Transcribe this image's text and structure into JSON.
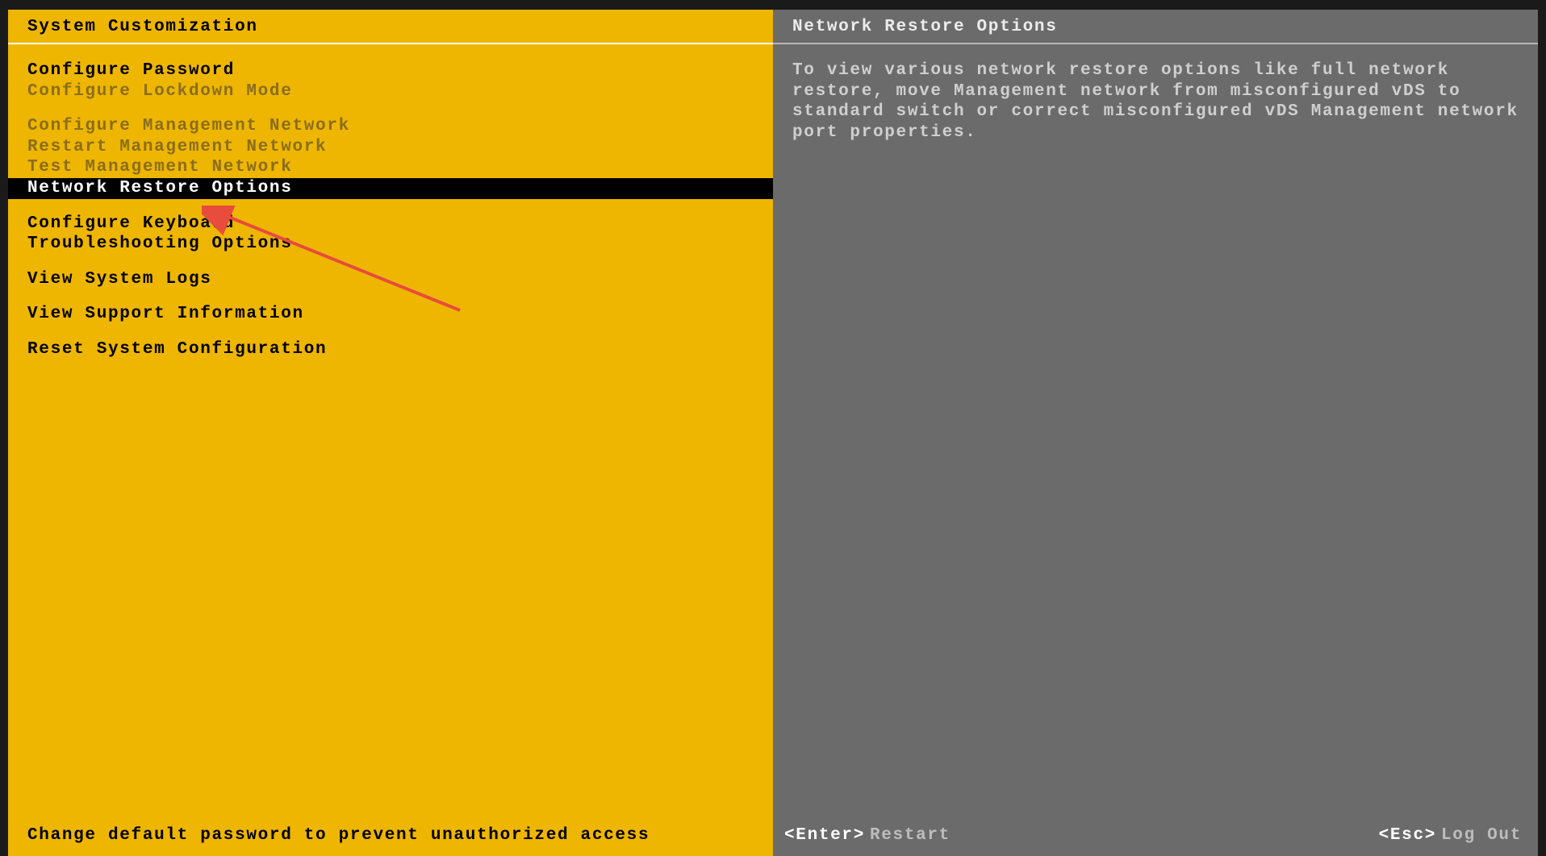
{
  "left": {
    "title": "System Customization",
    "footer": "Change default password to prevent unauthorized access",
    "groups": [
      [
        {
          "label": "Configure Password",
          "disabled": false,
          "selected": false
        },
        {
          "label": "Configure Lockdown Mode",
          "disabled": true,
          "selected": false
        }
      ],
      [
        {
          "label": "Configure Management Network",
          "disabled": true,
          "selected": false
        },
        {
          "label": "Restart Management Network",
          "disabled": true,
          "selected": false
        },
        {
          "label": "Test Management Network",
          "disabled": true,
          "selected": false
        },
        {
          "label": "Network Restore Options",
          "disabled": false,
          "selected": true
        }
      ],
      [
        {
          "label": "Configure Keyboard",
          "disabled": false,
          "selected": false
        },
        {
          "label": "Troubleshooting Options",
          "disabled": false,
          "selected": false
        }
      ],
      [
        {
          "label": "View System Logs",
          "disabled": false,
          "selected": false
        }
      ],
      [
        {
          "label": "View Support Information",
          "disabled": false,
          "selected": false
        }
      ],
      [
        {
          "label": "Reset System Configuration",
          "disabled": false,
          "selected": false
        }
      ]
    ]
  },
  "right": {
    "title": "Network Restore Options",
    "description": "To view various network restore options like full network restore, move Management network from misconfigured vDS to standard switch or correct misconfigured vDS Management network port properties.",
    "footer": {
      "enter_key": "<Enter>",
      "enter_action": "Restart",
      "esc_key": "<Esc>",
      "esc_action": "Log Out"
    }
  },
  "colors": {
    "left_bg": "#eeb600",
    "right_bg": "#6b6b6b",
    "arrow": "#e74c3c"
  }
}
